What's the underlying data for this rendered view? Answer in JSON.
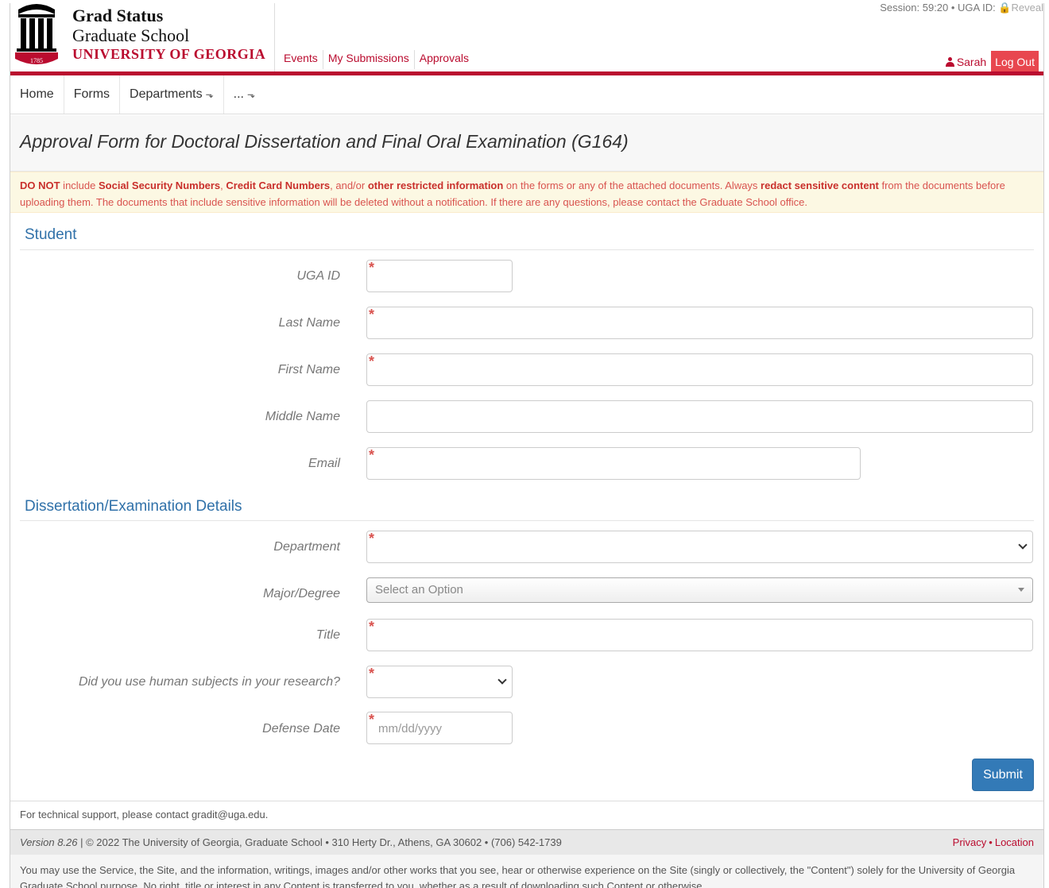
{
  "header": {
    "brand_title": "Grad Status",
    "brand_sub": "Graduate School",
    "brand_uni": "UNIVERSITY OF GEORGIA",
    "logo_year": "1785",
    "session": "Session: 59:20 • UGA ID: ",
    "reveal": "Reveal",
    "topnav": [
      "Events",
      "My Submissions",
      "Approvals"
    ],
    "user_name": "Sarah",
    "logout": "Log Out"
  },
  "subnav": {
    "home": "Home",
    "forms": "Forms",
    "departments": "Departments",
    "more": "...",
    "ext_glyph": "⬎"
  },
  "page": {
    "title": "Approval Form for Doctoral Dissertation and Final Oral Examination (G164)"
  },
  "warning": {
    "p1_bold": "DO NOT",
    "p2": " include ",
    "p3_bold": "Social Security Numbers",
    "p4": ", ",
    "p5_bold": "Credit Card Numbers",
    "p6": ", and/or ",
    "p7_bold": "other restricted information",
    "p8": " on the forms or any of the attached documents. Always ",
    "p9_bold": "redact sensitive content",
    "p10": " from the documents before uploading them. The documents that include sensitive information will be deleted without a notification. If there are any questions, please contact the Graduate School office."
  },
  "student": {
    "section": "Student",
    "uga_id": "UGA ID",
    "last_name": "Last Name",
    "first_name": "First Name",
    "middle_name": "Middle Name",
    "email": "Email"
  },
  "details": {
    "section": "Dissertation/Examination Details",
    "department": "Department",
    "major": "Major/Degree",
    "major_placeholder": "Select an Option",
    "title": "Title",
    "human_subjects": "Did you use human subjects in your research?",
    "defense_date": "Defense Date",
    "date_placeholder": "mm/dd/yyyy"
  },
  "required_mark": "*",
  "submit": "Submit",
  "footer": {
    "support": "For technical support, please contact gradit@uga.edu.",
    "version": "Version 8.26",
    "copyright": " | © 2022 The University of Georgia, Graduate School • 310 Herty Dr., Athens, GA 30602 • (706) 542-1739",
    "privacy": "Privacy",
    "dot": "•",
    "location": "Location",
    "terms": "You may use the Service, the Site, and the information, writings, images and/or other works that you see, hear or otherwise experience on the Site (singly or collectively, the \"Content\") solely for the University of Georgia Graduate School purpose. No right, title or interest in any Content is transferred to you, whether as a result of downloading such Content or otherwise."
  },
  "colors": {
    "brand_red": "#ba0c2f",
    "link_blue": "#3071a9",
    "submit_blue": "#337ab7",
    "warning_bg": "#fcf8e3"
  }
}
